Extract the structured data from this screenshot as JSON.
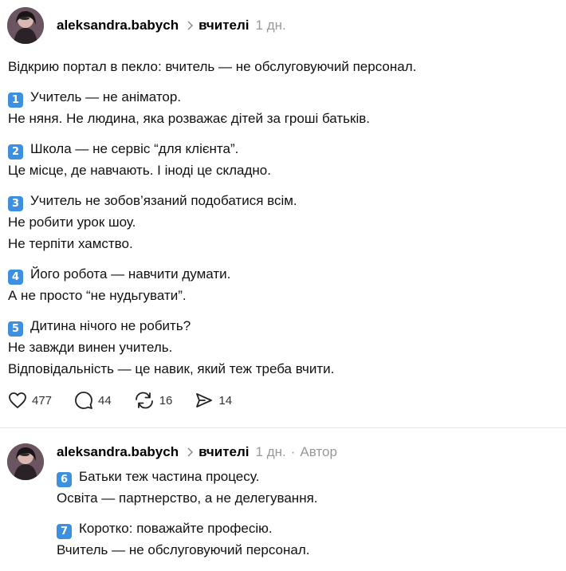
{
  "post": {
    "username": "aleksandra.babych",
    "topic": "вчителі",
    "time": "1 дн.",
    "intro": "Відкрию портал в пекло: вчитель — не обслуговуючий персонал.",
    "points": [
      {
        "badge": "1",
        "lines": [
          "Учитель — не аніматор.",
          "Не няня. Не людина, яка розважає дітей за гроші батьків."
        ]
      },
      {
        "badge": "2",
        "lines": [
          "Школа — не сервіс “для клієнта”.",
          "Це місце, де навчають. І іноді це складно."
        ]
      },
      {
        "badge": "3",
        "lines": [
          "Учитель не зобов’язаний подобатися всім.",
          "Не робити урок шоу.",
          "Не терпіти хамство."
        ]
      },
      {
        "badge": "4",
        "lines": [
          "Його робота — навчити думати.",
          "А не просто “не нудьгувати”."
        ]
      },
      {
        "badge": "5",
        "lines": [
          "Дитина нічого не робить?",
          "Не завжди винен учитель.",
          "Відповідальність — це навик, який теж треба вчити."
        ]
      }
    ],
    "actions": {
      "likes": "477",
      "comments": "44",
      "reposts": "16",
      "shares": "14"
    }
  },
  "reply": {
    "username": "aleksandra.babych",
    "topic": "вчителі",
    "time": "1 дн.",
    "separator": "·",
    "author_label": "Автор",
    "points": [
      {
        "badge": "6",
        "lines": [
          "Батьки теж частина процесу.",
          "Освіта — партнерство, а не делегування."
        ]
      },
      {
        "badge": "7",
        "lines": [
          "Коротко: поважайте професію.",
          "Вчитель — не обслуговуючий персонал."
        ]
      }
    ]
  },
  "colors": {
    "badge": "#3d8fe0",
    "meta": "#999999",
    "divider": "#e5e5e5"
  }
}
